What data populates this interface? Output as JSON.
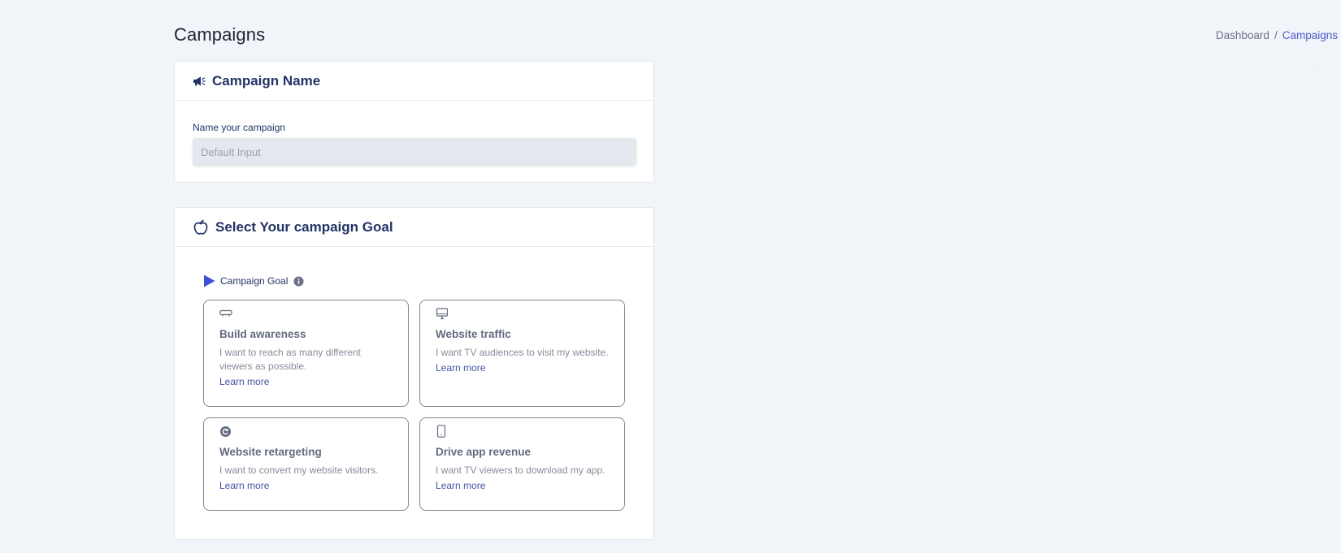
{
  "page": {
    "title": "Campaigns"
  },
  "breadcrumb": {
    "items": [
      "Dashboard",
      "/",
      "Campaigns"
    ]
  },
  "campaign_name_card": {
    "title": "Campaign Name",
    "icon": "megaphone-icon",
    "field_label": "Name your campaign",
    "input_value": "",
    "input_placeholder": "Default Input"
  },
  "goal_card": {
    "title": "Select Your campaign Goal",
    "icon": "apple-icon",
    "goal_label": "Campaign Goal",
    "goals": [
      {
        "icon": "tv-remote-icon",
        "title": "Build awareness",
        "description": "I want to reach as many different viewers as possible.",
        "link": "Learn more"
      },
      {
        "icon": "monitor-icon",
        "title": "Website traffic",
        "description": "I want TV audiences to visit my website.",
        "link": "Learn more"
      },
      {
        "icon": "circle-arrow-icon",
        "title": "Website retargeting",
        "description": "I want to convert my website visitors.",
        "link": "Learn more"
      },
      {
        "icon": "mobile-phone-icon",
        "title": "Drive app revenue",
        "description": "I want TV viewers to download my app.",
        "link": "Learn more"
      }
    ]
  },
  "colors": {
    "accent": "#4b5bc6",
    "heading": "#243366",
    "background": "#f1f4f9",
    "play_marker": "#3f4fd6"
  }
}
